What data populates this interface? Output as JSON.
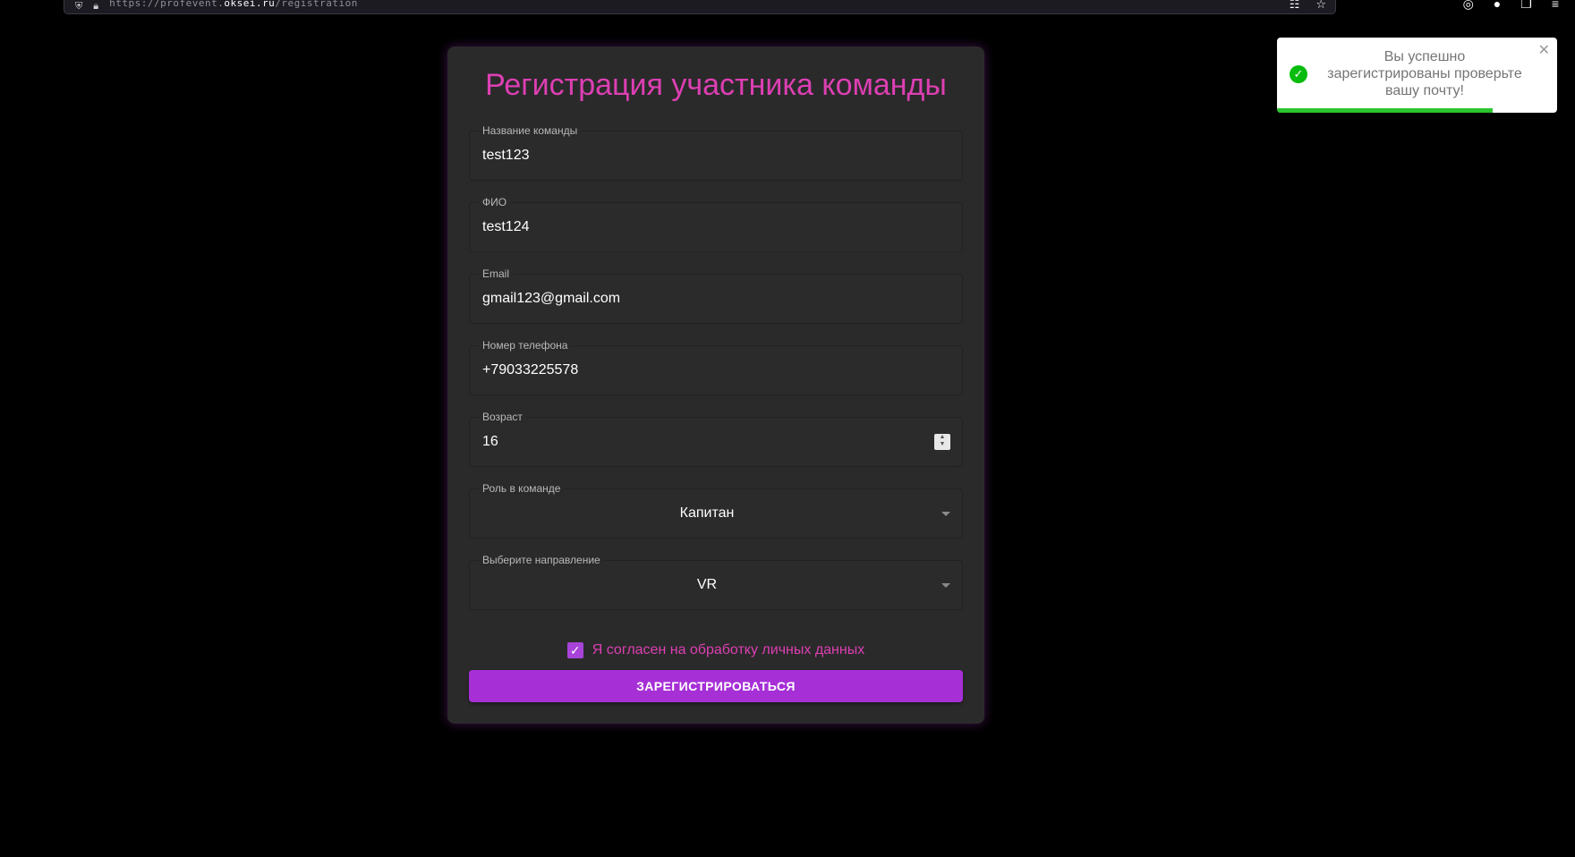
{
  "browser": {
    "url_prefix": "https://",
    "url_sub": "profevent.",
    "url_host": "oksei.ru",
    "url_path": "/registration"
  },
  "form": {
    "title": "Регистрация участника команды",
    "fields": [
      {
        "label": "Название команды",
        "value": "test123"
      },
      {
        "label": "ФИО",
        "value": "test124"
      },
      {
        "label": "Email",
        "value": "gmail123@gmail.com"
      },
      {
        "label": "Номер телефона",
        "value": "+79033225578"
      },
      {
        "label": "Возраст",
        "value": "16"
      },
      {
        "label": "Роль в команде",
        "value": "Капитан"
      },
      {
        "label": "Выберите направление",
        "value": "VR"
      }
    ],
    "consent_label": "Я согласен на обработку личных данных",
    "consent_checked": true,
    "submit_label": "Зарегистрироваться"
  },
  "toast": {
    "message": "Вы успешно зарегистрированы проверьте вашу почту!",
    "progress_fraction": 0.77,
    "status_color": "#07bc0c"
  },
  "colors": {
    "accent": "#dd3fb3",
    "button": "#a62fd6"
  }
}
